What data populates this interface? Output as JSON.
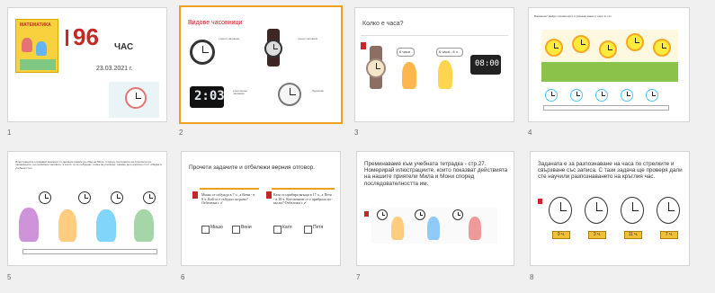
{
  "slides": [
    {
      "number": "1",
      "book_title": "МАТЕМАТИКА",
      "lesson_num": "96",
      "lesson_word": "ЧАС",
      "date": "23.03.2021 г."
    },
    {
      "number": "2",
      "title": "Видове часовници",
      "labels": [
        "стенен часовник",
        "ръчен часовник",
        "електронен часовник",
        "будилник"
      ],
      "digital": "2:03"
    },
    {
      "number": "3",
      "title": "Колко е часа?",
      "bubble1": "6 часа",
      "bubble2": "6 часа - 8 ч.",
      "digital": "08:00"
    },
    {
      "number": "4",
      "text": "Внимание! Найди часовниците и разкажи какво е часа по тях."
    },
    {
      "number": "5",
      "text": "Илюстрациите отразяват моменти от дневния режим до обяд на Мили. Сторед, погледнете на стрелките на часовниците, що написани часовете, в които те се събуждат, отива на училище, чакаме да е изрично стоп, обядва в учебния стол."
    },
    {
      "number": "6",
      "title": "Прочети задачите и отбележи верния отговор.",
      "q1": "Мишо се събужда в 7 ч., а Вени - в 8 ч. Кой се е събудил по-рано? Отбележи с",
      "q2": "Катя се прибира вкъщи в 17 ч., а Петя - в 18 ч. Кое момиче се е прибрало по-късно? Отбележи с",
      "opt1": "Мишо",
      "opt2": "Вени",
      "opt3": "Катя",
      "opt4": "Петя",
      "check": "✓"
    },
    {
      "number": "7",
      "text": "Преминаваме към учебната тетрадка - стр.27. Номерирай илюстрациите, които показват действията на нашите приятели Мила и Мони според последователността им."
    },
    {
      "number": "8",
      "text": "Задачата е за разпознаване на часа по стрелките и свързване със записа. С тази задача ще проверя дали сте научили разпознаването на кръглия час.",
      "times": [
        "9 ч.",
        "3 ч.",
        "11 ч.",
        "7 ч."
      ]
    }
  ]
}
